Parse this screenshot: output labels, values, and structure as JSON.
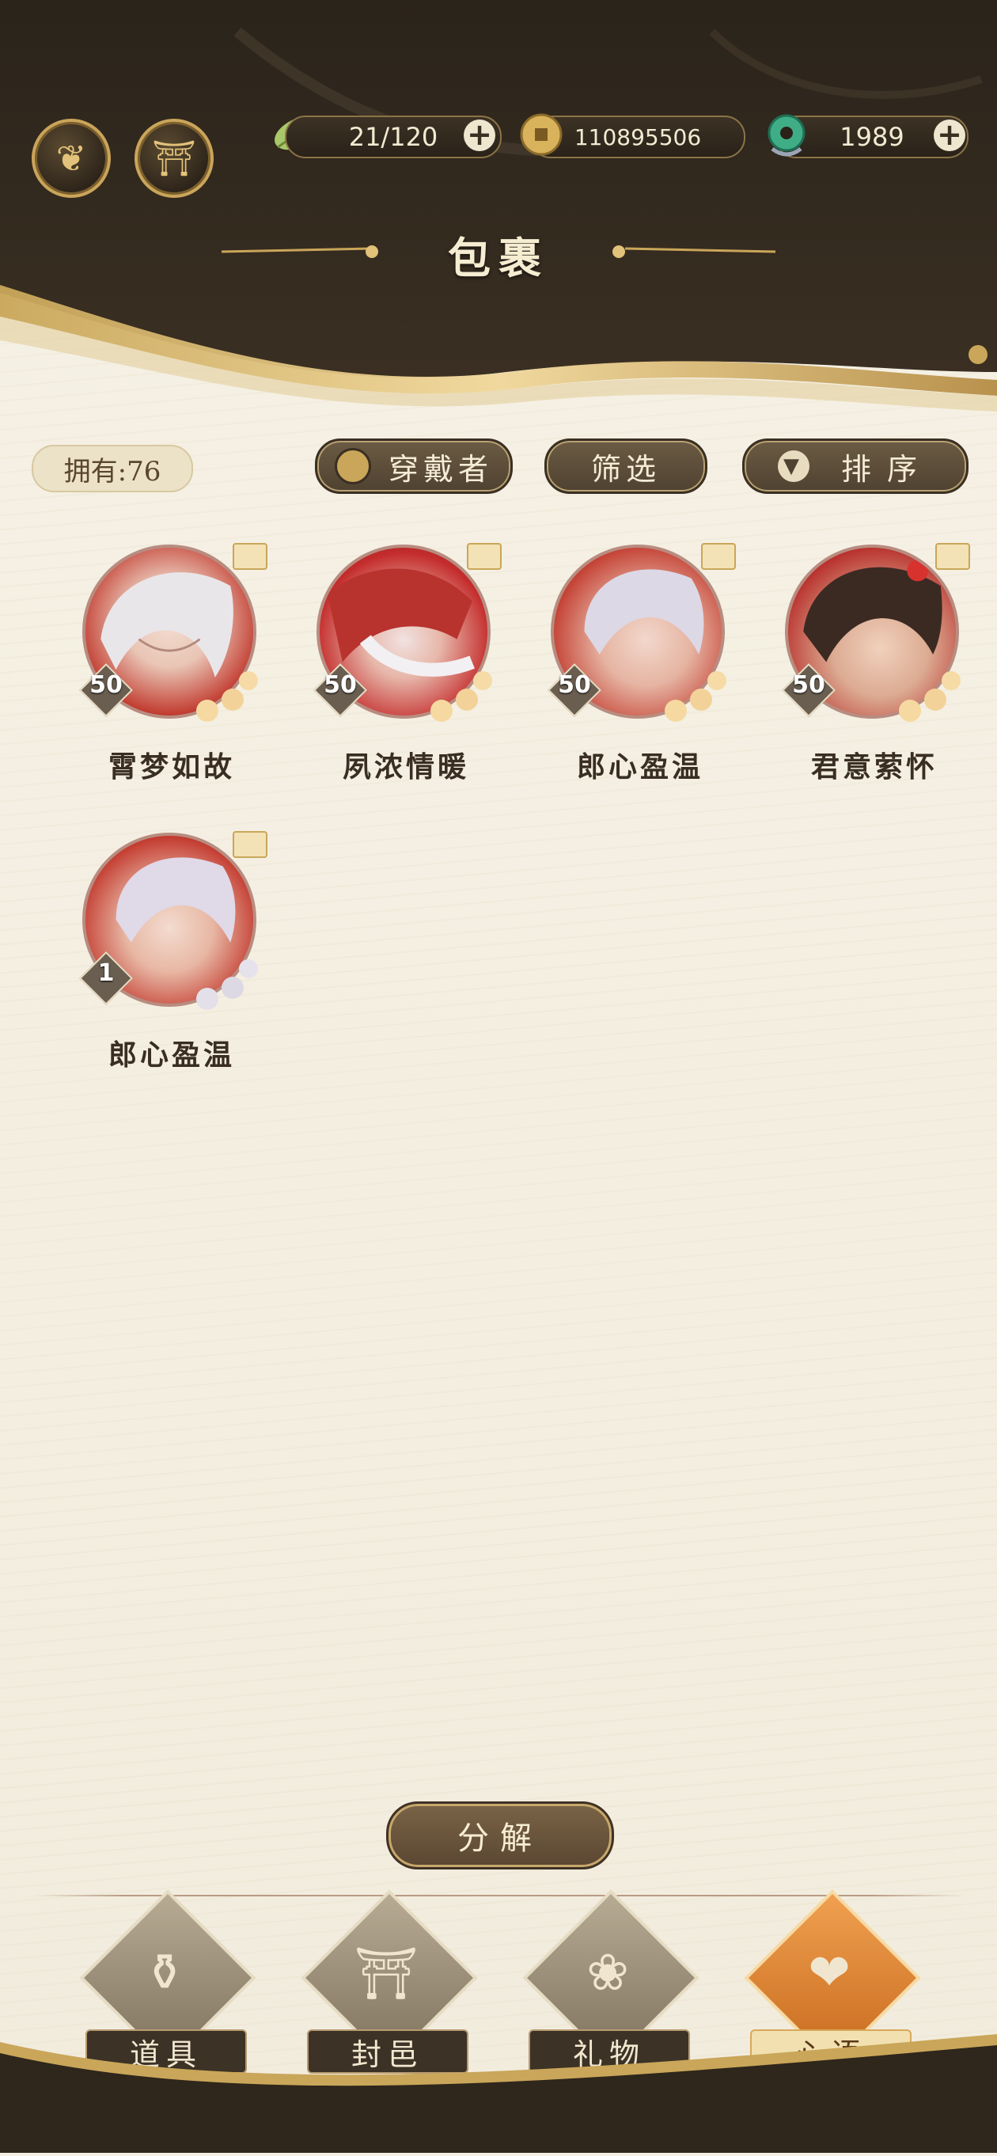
{
  "header": {
    "title": "包裹",
    "resources": [
      {
        "icon": "leaf-icon",
        "value": "21/120",
        "has_plus": true
      },
      {
        "icon": "coin-icon",
        "value": "110895506",
        "has_plus": false
      },
      {
        "icon": "jade-icon",
        "value": "1989",
        "has_plus": true
      }
    ],
    "plus_label": "+"
  },
  "toolbar": {
    "owned": "拥有:76",
    "wearer_label": "穿戴者",
    "filter_label": "筛选",
    "sort_label": "排序"
  },
  "items": [
    {
      "name": "霄梦如故",
      "level": "50"
    },
    {
      "name": "夙浓情暖",
      "level": "50"
    },
    {
      "name": "郎心盈温",
      "level": "50"
    },
    {
      "name": "君意萦怀",
      "level": "50"
    },
    {
      "name": "郎心盈温",
      "level": "1"
    }
  ],
  "actions": {
    "decompose": "分解"
  },
  "bottom_nav": {
    "items": [
      {
        "label": "道具",
        "icon": "items-jar-icon",
        "active": false
      },
      {
        "label": "封邑",
        "icon": "pavilion-icon",
        "active": false
      },
      {
        "label": "礼物",
        "icon": "fan-gift-icon",
        "active": false
      },
      {
        "label": "心语",
        "icon": "heart-lotus-icon",
        "active": true
      }
    ]
  },
  "colors": {
    "header_dark": "#2f261c",
    "gold": "#c9a659",
    "paper": "#f4efe2",
    "active_tab": "#e8892f"
  }
}
